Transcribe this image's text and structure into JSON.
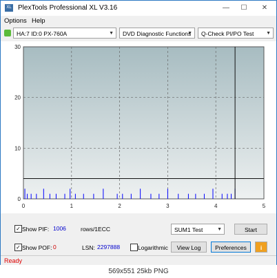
{
  "window": {
    "title": "PlexTools Professional XL V3.16",
    "min": "—",
    "max": "☐",
    "close": "✕"
  },
  "menu": {
    "options": "Options",
    "help": "Help"
  },
  "toolbar": {
    "drive": "HA:7 ID:0  PX-760A",
    "function": "DVD Diagnostic Functions",
    "test": "Q-Check PI/PO Test"
  },
  "chart_data": {
    "type": "bar",
    "x_ticks": [
      "0",
      "1",
      "2",
      "3",
      "4",
      "5"
    ],
    "y_ticks": [
      "0",
      "10",
      "20",
      "30"
    ],
    "xlim": [
      0,
      5
    ],
    "ylim": [
      0,
      30
    ],
    "threshold": 4,
    "cursor_x": 4.4,
    "grid": true,
    "series": [
      {
        "color": "#0000ff",
        "x": [
          0.03,
          0.08,
          0.16,
          0.27,
          0.42,
          0.55,
          0.68,
          0.86,
          0.97,
          1.08,
          1.25,
          1.46,
          1.66,
          1.95,
          2.06,
          2.24,
          2.43,
          2.65,
          2.82,
          3.0,
          3.22,
          3.43,
          3.58,
          3.76,
          3.94,
          4.13,
          4.24,
          4.32,
          4.4
        ],
        "y": [
          2,
          1,
          1,
          1,
          2,
          1,
          1,
          1,
          2,
          1,
          1,
          1,
          2,
          1,
          1,
          1,
          2,
          1,
          1,
          2,
          1,
          1,
          1,
          1,
          2,
          1,
          1,
          1,
          2
        ]
      }
    ]
  },
  "controls": {
    "show_pif_label": "Show PIF:",
    "pif_value": "1006",
    "rows_label": "rows/1ECC",
    "show_pof_label": "Show POF:",
    "pof_value": "0",
    "lsn_label": "LSN:",
    "lsn_value": "2297888",
    "log_label": "Logarithmic",
    "sum_select": "SUM1 Test",
    "start": "Start",
    "view_log": "View Log",
    "preferences": "Preferences",
    "info_icon": "i"
  },
  "status": "Ready",
  "caption": "569x551  25kb  PNG"
}
